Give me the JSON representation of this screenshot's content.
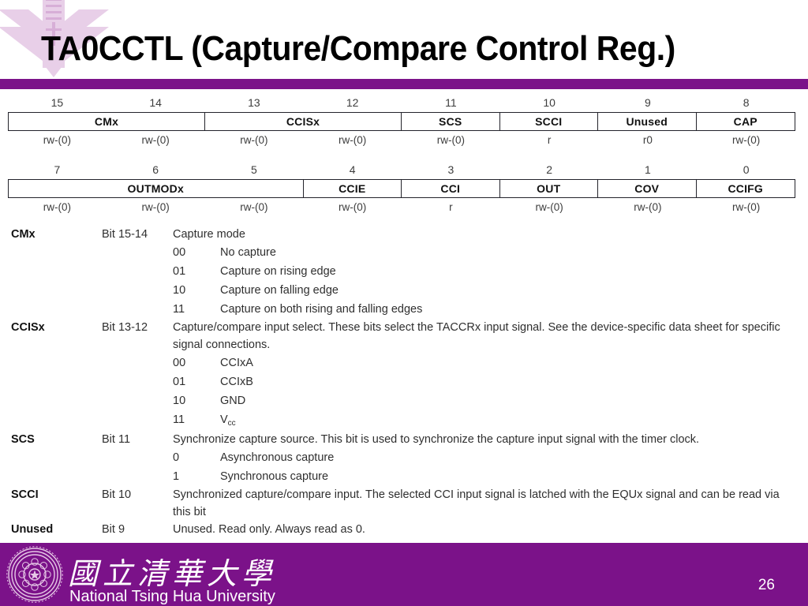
{
  "slide": {
    "title": "TA0CCTL (Capture/Compare Control Reg.)",
    "page_number": "26",
    "accent_color": "#7b1289"
  },
  "register": {
    "high_byte": {
      "bit_numbers": [
        "15",
        "14",
        "13",
        "12",
        "11",
        "10",
        "9",
        "8"
      ],
      "fields": [
        {
          "name": "CMx",
          "span": 2
        },
        {
          "name": "CCISx",
          "span": 2
        },
        {
          "name": "SCS",
          "span": 1
        },
        {
          "name": "SCCI",
          "span": 1
        },
        {
          "name": "Unused",
          "span": 1
        },
        {
          "name": "CAP",
          "span": 1
        }
      ],
      "access": [
        "rw-(0)",
        "rw-(0)",
        "rw-(0)",
        "rw-(0)",
        "rw-(0)",
        "r",
        "r0",
        "rw-(0)"
      ]
    },
    "low_byte": {
      "bit_numbers": [
        "7",
        "6",
        "5",
        "4",
        "3",
        "2",
        "1",
        "0"
      ],
      "fields": [
        {
          "name": "OUTMODx",
          "span": 3
        },
        {
          "name": "CCIE",
          "span": 1
        },
        {
          "name": "CCI",
          "span": 1
        },
        {
          "name": "OUT",
          "span": 1
        },
        {
          "name": "COV",
          "span": 1
        },
        {
          "name": "CCIFG",
          "span": 1
        }
      ],
      "access": [
        "rw-(0)",
        "rw-(0)",
        "rw-(0)",
        "rw-(0)",
        "r",
        "rw-(0)",
        "rw-(0)",
        "rw-(0)"
      ]
    }
  },
  "descriptions": [
    {
      "name": "CMx",
      "bit": "Bit 15-14",
      "text": "Capture mode",
      "options": [
        {
          "code": "00",
          "label": "No capture"
        },
        {
          "code": "01",
          "label": "Capture on rising edge"
        },
        {
          "code": "10",
          "label": "Capture on falling edge"
        },
        {
          "code": "11",
          "label": "Capture on both rising and falling edges"
        }
      ]
    },
    {
      "name": "CCISx",
      "bit": "Bit 13-12",
      "text": "Capture/compare input select. These bits select the TACCRx input signal. See the device-specific data sheet for specific signal connections.",
      "options": [
        {
          "code": "00",
          "label": "CCIxA"
        },
        {
          "code": "01",
          "label": "CCIxB"
        },
        {
          "code": "10",
          "label": "GND"
        },
        {
          "code": "11",
          "label": "Vcc",
          "sub": "cc",
          "base": "V"
        }
      ]
    },
    {
      "name": "SCS",
      "bit": "Bit 11",
      "text": "Synchronize capture source. This bit is used to synchronize the capture input signal with the timer clock.",
      "options": [
        {
          "code": "0",
          "label": "Asynchronous capture"
        },
        {
          "code": "1",
          "label": "Synchronous capture"
        }
      ]
    },
    {
      "name": "SCCI",
      "bit": "Bit 10",
      "text": "Synchronized capture/compare input. The selected CCI input signal is latched with the EQUx signal and can be read via this bit",
      "options": []
    },
    {
      "name": "Unused",
      "bit": "Bit 9",
      "text": "Unused. Read only. Always read as 0.",
      "options": []
    }
  ],
  "footer": {
    "university_cn": "國立清華大學",
    "university_en": "National Tsing Hua University"
  }
}
